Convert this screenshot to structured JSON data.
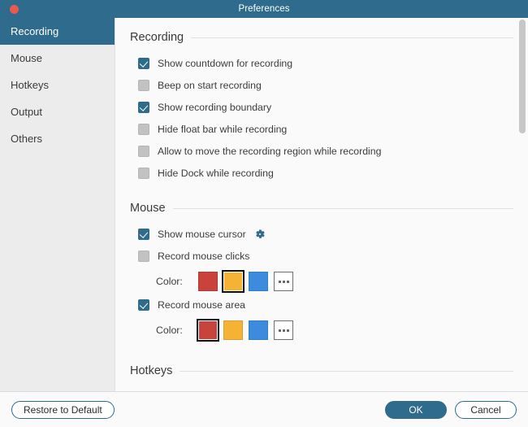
{
  "titlebar": {
    "title": "Preferences",
    "close_icon": "close-icon",
    "bg_color": "#2e6b8c",
    "close_color": "#e8594f"
  },
  "sidebar": {
    "items": [
      {
        "label": "Recording",
        "selected": true
      },
      {
        "label": "Mouse",
        "selected": false
      },
      {
        "label": "Hotkeys",
        "selected": false
      },
      {
        "label": "Output",
        "selected": false
      },
      {
        "label": "Others",
        "selected": false
      }
    ]
  },
  "sections": {
    "recording": {
      "title": "Recording",
      "options": [
        {
          "label": "Show countdown for recording",
          "checked": true
        },
        {
          "label": "Beep on start recording",
          "checked": false
        },
        {
          "label": "Show recording boundary",
          "checked": true
        },
        {
          "label": "Hide float bar while recording",
          "checked": false
        },
        {
          "label": "Allow to move the recording region while recording",
          "checked": false
        },
        {
          "label": "Hide Dock while recording",
          "checked": false
        }
      ]
    },
    "mouse": {
      "title": "Mouse",
      "show_cursor": {
        "label": "Show mouse cursor",
        "checked": true,
        "gear_icon": "gear-icon"
      },
      "record_clicks": {
        "label": "Record mouse clicks",
        "checked": false
      },
      "clicks_color": {
        "label": "Color:",
        "swatches": [
          {
            "name": "red",
            "color": "#c9423c",
            "selected": false
          },
          {
            "name": "yellow",
            "color": "#f5b335",
            "selected": true
          },
          {
            "name": "blue",
            "color": "#3c8bdc",
            "selected": false
          }
        ],
        "more_label": "..."
      },
      "record_area": {
        "label": "Record mouse area",
        "checked": true
      },
      "area_color": {
        "label": "Color:",
        "swatches": [
          {
            "name": "red",
            "color": "#c9423c",
            "selected": true
          },
          {
            "name": "yellow",
            "color": "#f5b335",
            "selected": false
          },
          {
            "name": "blue",
            "color": "#3c8bdc",
            "selected": false
          }
        ],
        "more_label": "..."
      }
    },
    "hotkeys": {
      "title": "Hotkeys"
    }
  },
  "footer": {
    "restore_label": "Restore to Default",
    "ok_label": "OK",
    "cancel_label": "Cancel"
  },
  "accent_color": "#2e6b8c"
}
